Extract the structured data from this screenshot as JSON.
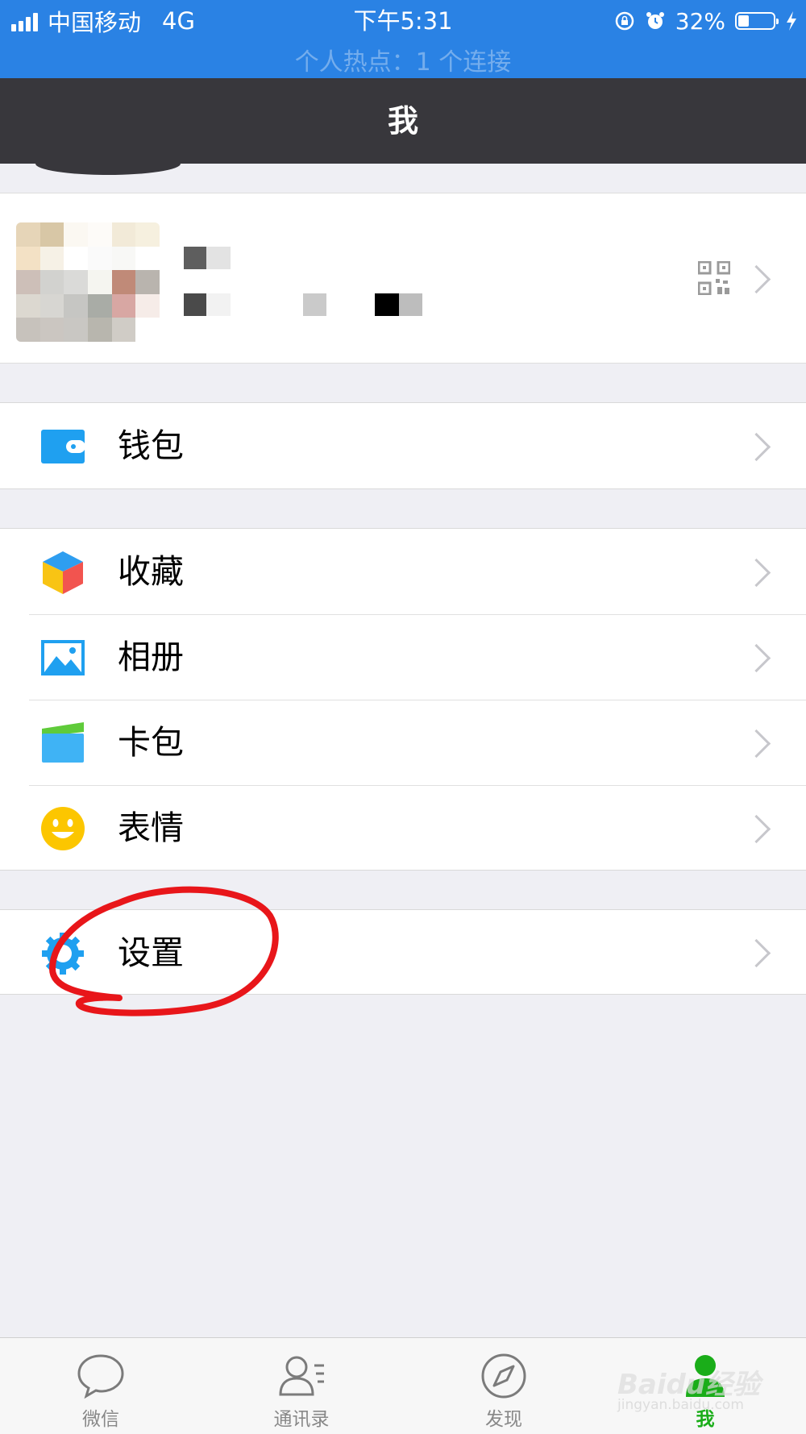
{
  "status_bar": {
    "carrier": "中国移动",
    "network": "4G",
    "time": "下午5:31",
    "battery_percent": "32%",
    "battery_level": 0.32,
    "hotspot_text": "个人热点：1 个连接",
    "background": "#2a82e4"
  },
  "navbar": {
    "title": "我",
    "background": "#38373c"
  },
  "menu": {
    "wallet": {
      "label": "钱包",
      "icon": "wallet-icon"
    },
    "favorites": {
      "label": "收藏",
      "icon": "cube-icon"
    },
    "album": {
      "label": "相册",
      "icon": "picture-icon"
    },
    "cards": {
      "label": "卡包",
      "icon": "card-icon"
    },
    "stickers": {
      "label": "表情",
      "icon": "smiley-icon"
    },
    "settings": {
      "label": "设置",
      "icon": "gear-icon"
    }
  },
  "tabbar": {
    "chats": {
      "label": "微信",
      "icon": "chat-bubble-icon"
    },
    "contacts": {
      "label": "通讯录",
      "icon": "contacts-icon"
    },
    "discover": {
      "label": "发现",
      "icon": "compass-icon"
    },
    "me": {
      "label": "我",
      "icon": "person-icon",
      "active_color": "#1aad19"
    }
  },
  "watermark": {
    "line1": "Baidu经验",
    "line2": "jingyan.baidu.com"
  }
}
